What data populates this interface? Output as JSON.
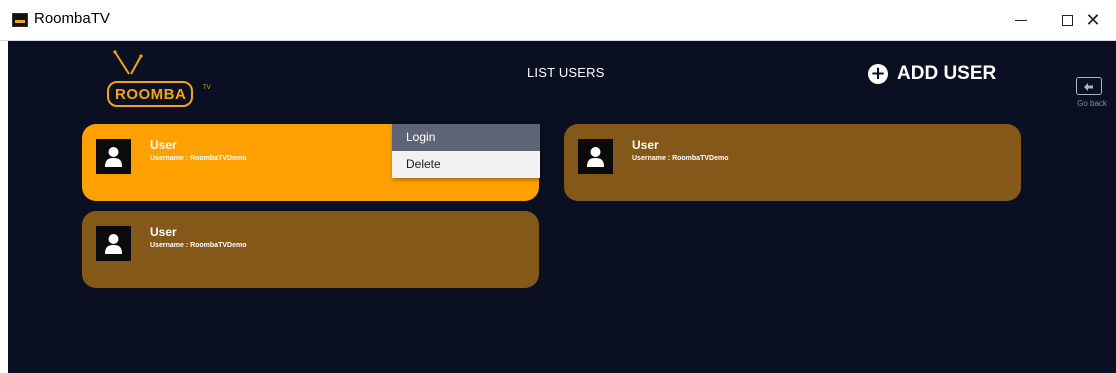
{
  "window": {
    "title": "RoombaTV",
    "minimize_label": "—",
    "maximize_label": "☐",
    "close_label": "✕"
  },
  "header": {
    "logo_text": "ROOMBA",
    "logo_tm": "TV",
    "page_title": "LIST USERS",
    "add_user_icon": "+",
    "add_user_label": "ADD USER",
    "go_back_label": "Go back"
  },
  "users": [
    {
      "name": "User",
      "username": "Username : RoombaTVDemo"
    },
    {
      "name": "User",
      "username": "Username : RoombaTVDemo"
    },
    {
      "name": "User",
      "username": "Username : RoombaTVDemo"
    }
  ],
  "context_menu": {
    "items": [
      {
        "label": "Login"
      },
      {
        "label": "Delete"
      }
    ]
  },
  "colors": {
    "background": "#0b0f22",
    "accent": "#f2a516",
    "card_active": "#fea100",
    "card": "#835818",
    "menu_highlight": "#5f6377"
  },
  "icons": {
    "app": "roomba-tv-app-icon",
    "add_user": "plus-circle-icon",
    "go_back": "go-back-icon",
    "avatar": "user-silhouette-icon"
  }
}
